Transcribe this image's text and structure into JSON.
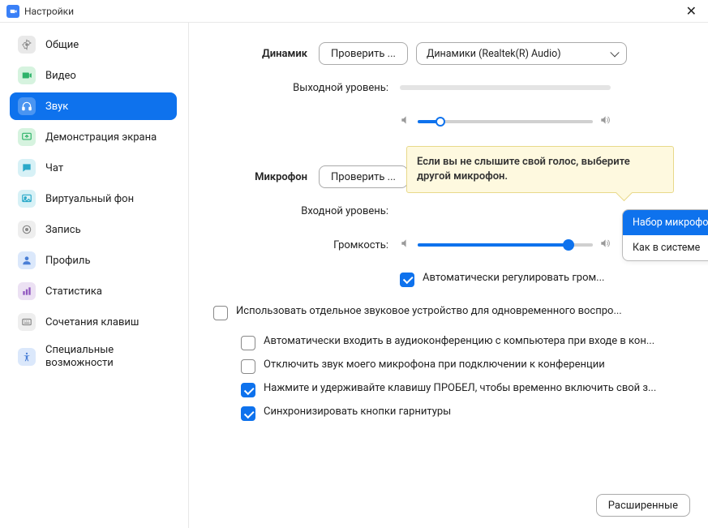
{
  "title": "Настройки",
  "sidebar": {
    "items": [
      {
        "label": "Общие"
      },
      {
        "label": "Видео"
      },
      {
        "label": "Звук"
      },
      {
        "label": "Демонстрация экрана"
      },
      {
        "label": "Чат"
      },
      {
        "label": "Виртуальный фон"
      },
      {
        "label": "Запись"
      },
      {
        "label": "Профиль"
      },
      {
        "label": "Статистика"
      },
      {
        "label": "Сочетания клавиш"
      },
      {
        "label": "Специальные возможности"
      }
    ]
  },
  "speaker": {
    "section_label": "Динамик",
    "test_label": "Проверить ...",
    "device": "Динамики (Realtek(R) Audio)",
    "output_level_label": "Выходной уровень:"
  },
  "mic": {
    "section_label": "Микрофон",
    "test_label": "Проверить ...",
    "device": "Набор микрофонов (Realtek(R) ...",
    "input_level_label": "Входной уровень:",
    "volume_label": "Громкость:",
    "auto_adjust_label": "Автоматически регулировать гром...",
    "dropdown_options": [
      "Набор микрофонов (Realtek(R) Audio)",
      "Как в системе"
    ]
  },
  "tooltip_text": "Если вы не слышите свой голос, выберите другой микрофон.",
  "checks": {
    "separate_device": "Использовать отдельное звуковое устройство для одновременного воспро...",
    "auto_join": "Автоматически входить в аудиоконференцию с компьютера при входе в кон...",
    "mute_on_join": "Отключить звук моего микрофона при подключении к конференции",
    "push_space": "Нажмите и удерживайте клавишу ПРОБЕЛ, чтобы временно включить свой з...",
    "sync_headset": "Синхронизировать кнопки гарнитуры"
  },
  "advanced_label": "Расширенные",
  "volume_pct": 86
}
